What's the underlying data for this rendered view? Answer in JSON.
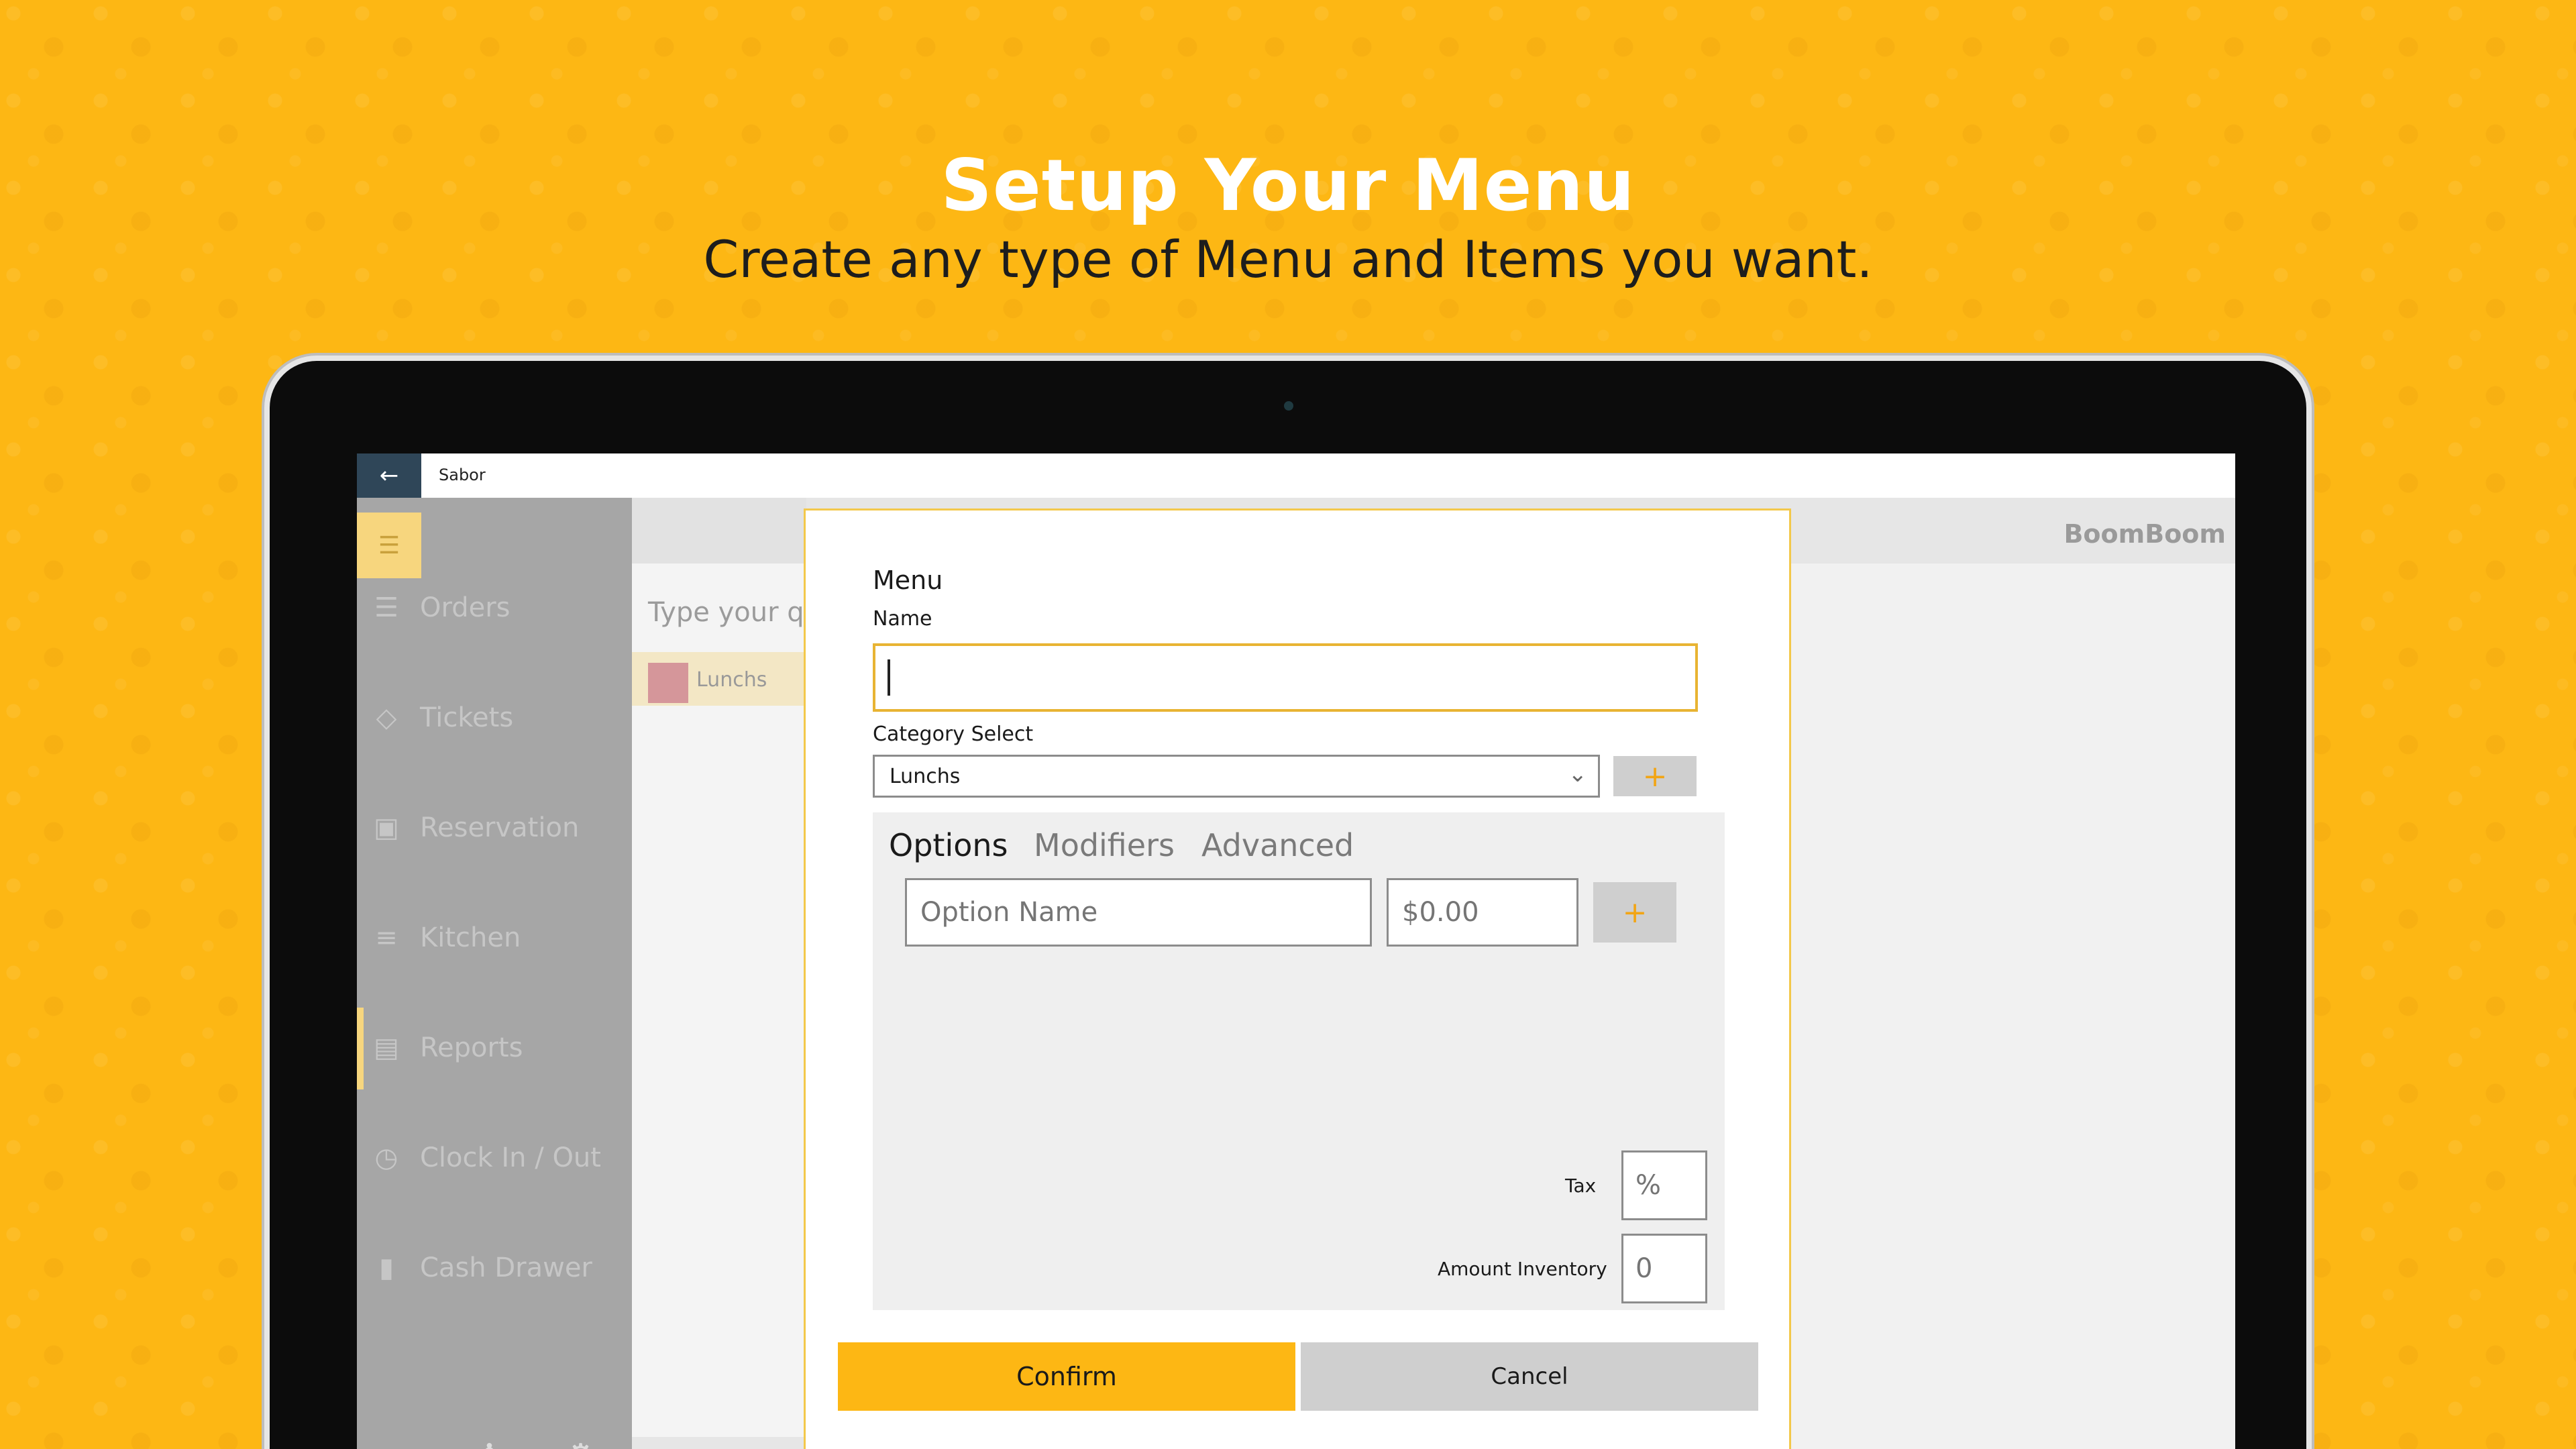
{
  "banner": {
    "headline": "Setup Your Menu",
    "subline": "Create any type of Menu and Items you want."
  },
  "app": {
    "title": "Sabor",
    "brand": "BoomBoom"
  },
  "sidebar": {
    "items": [
      {
        "label": "Orders",
        "icon": "list-icon"
      },
      {
        "label": "Tickets",
        "icon": "ticket-icon"
      },
      {
        "label": "Reservation",
        "icon": "calendar-icon"
      },
      {
        "label": "Kitchen",
        "icon": "checklist-icon"
      },
      {
        "label": "Reports",
        "icon": "report-icon",
        "active": true
      },
      {
        "label": "Clock In / Out",
        "icon": "clock-icon"
      },
      {
        "label": "Cash Drawer",
        "icon": "cash-drawer-icon"
      }
    ]
  },
  "list_panel": {
    "search_placeholder": "Type your qu",
    "items": [
      {
        "label": "Lunchs",
        "color": "#d5969a"
      }
    ]
  },
  "dialog": {
    "title": "Menu",
    "name_label": "Name",
    "name_value": "",
    "category_label": "Category Select",
    "category_value": "Lunchs",
    "tabs": [
      "Options",
      "Modifiers",
      "Advanced"
    ],
    "active_tab": "Options",
    "option_name_placeholder": "Option Name",
    "option_price_placeholder": "$0.00",
    "tax_label": "Tax",
    "tax_placeholder": "%",
    "inventory_label": "Amount Inventory",
    "inventory_placeholder": "0",
    "confirm_label": "Confirm",
    "cancel_label": "Cancel"
  },
  "colors": {
    "background": "#fdb714",
    "accent": "#fdb714",
    "sidebar": "#a6a6a6",
    "titlebar_back": "#2f4658"
  }
}
